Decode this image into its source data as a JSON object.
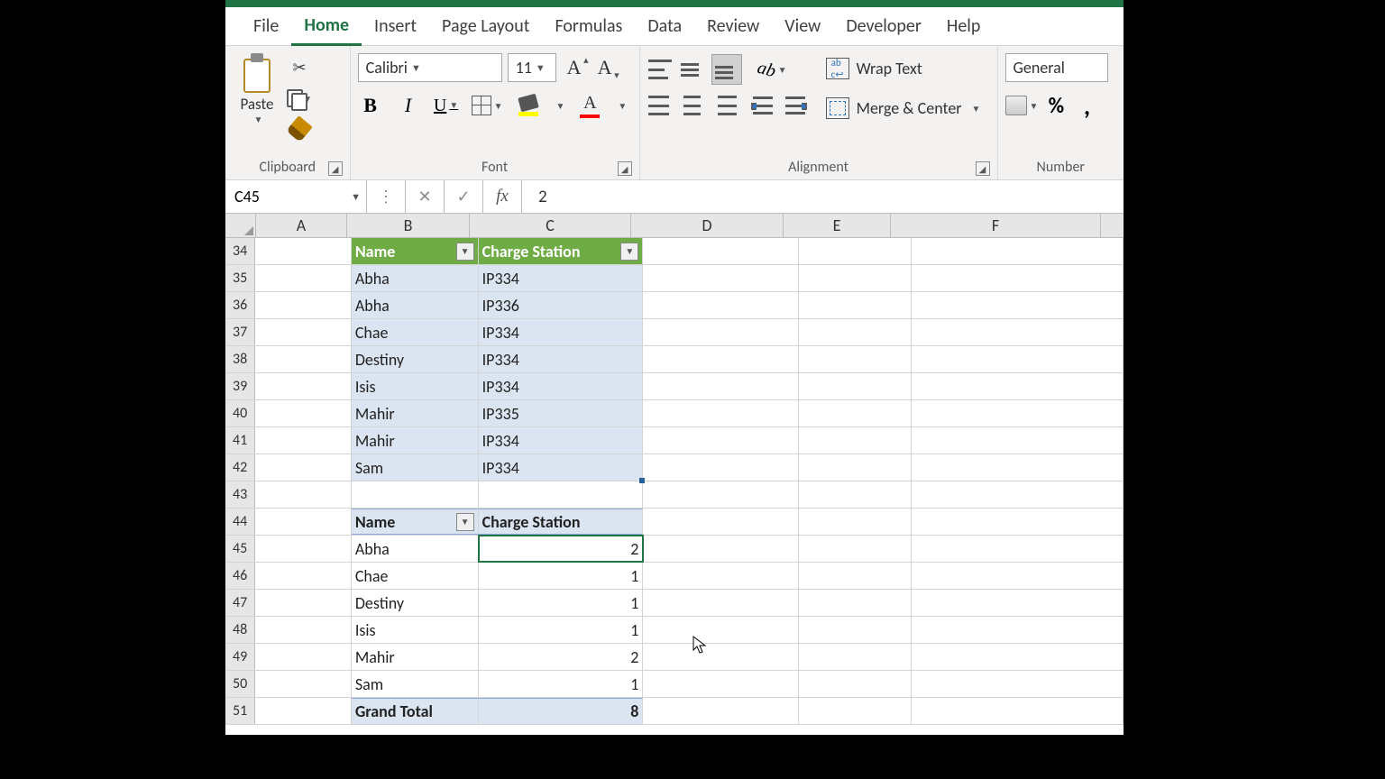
{
  "tabs": [
    "File",
    "Home",
    "Insert",
    "Page Layout",
    "Formulas",
    "Data",
    "Review",
    "View",
    "Developer",
    "Help"
  ],
  "active_tab": "Home",
  "clipboard": {
    "paste": "Paste",
    "group": "Clipboard"
  },
  "font": {
    "name": "Calibri",
    "size": "11",
    "group": "Font"
  },
  "alignment": {
    "wrap": "Wrap Text",
    "merge": "Merge & Center",
    "group": "Alignment"
  },
  "number": {
    "format": "General",
    "group": "Number"
  },
  "namebox": "C45",
  "formula": "2",
  "columns": [
    "A",
    "B",
    "C",
    "D",
    "E",
    "F"
  ],
  "row_start": 34,
  "table": {
    "headers": [
      "Name",
      "Charge Station"
    ],
    "rows": [
      [
        "Abha",
        "IP334"
      ],
      [
        "Abha",
        "IP336"
      ],
      [
        "Chae",
        "IP334"
      ],
      [
        "Destiny",
        "IP334"
      ],
      [
        "Isis",
        "IP334"
      ],
      [
        "Mahir",
        "IP335"
      ],
      [
        "Mahir",
        "IP334"
      ],
      [
        "Sam",
        "IP334"
      ]
    ]
  },
  "pivot": {
    "headers": [
      "Name",
      "Charge Station"
    ],
    "rows": [
      [
        "Abha",
        "2"
      ],
      [
        "Chae",
        "1"
      ],
      [
        "Destiny",
        "1"
      ],
      [
        "Isis",
        "1"
      ],
      [
        "Mahir",
        "2"
      ],
      [
        "Sam",
        "1"
      ]
    ],
    "total_label": "Grand Total",
    "total_value": "8"
  }
}
